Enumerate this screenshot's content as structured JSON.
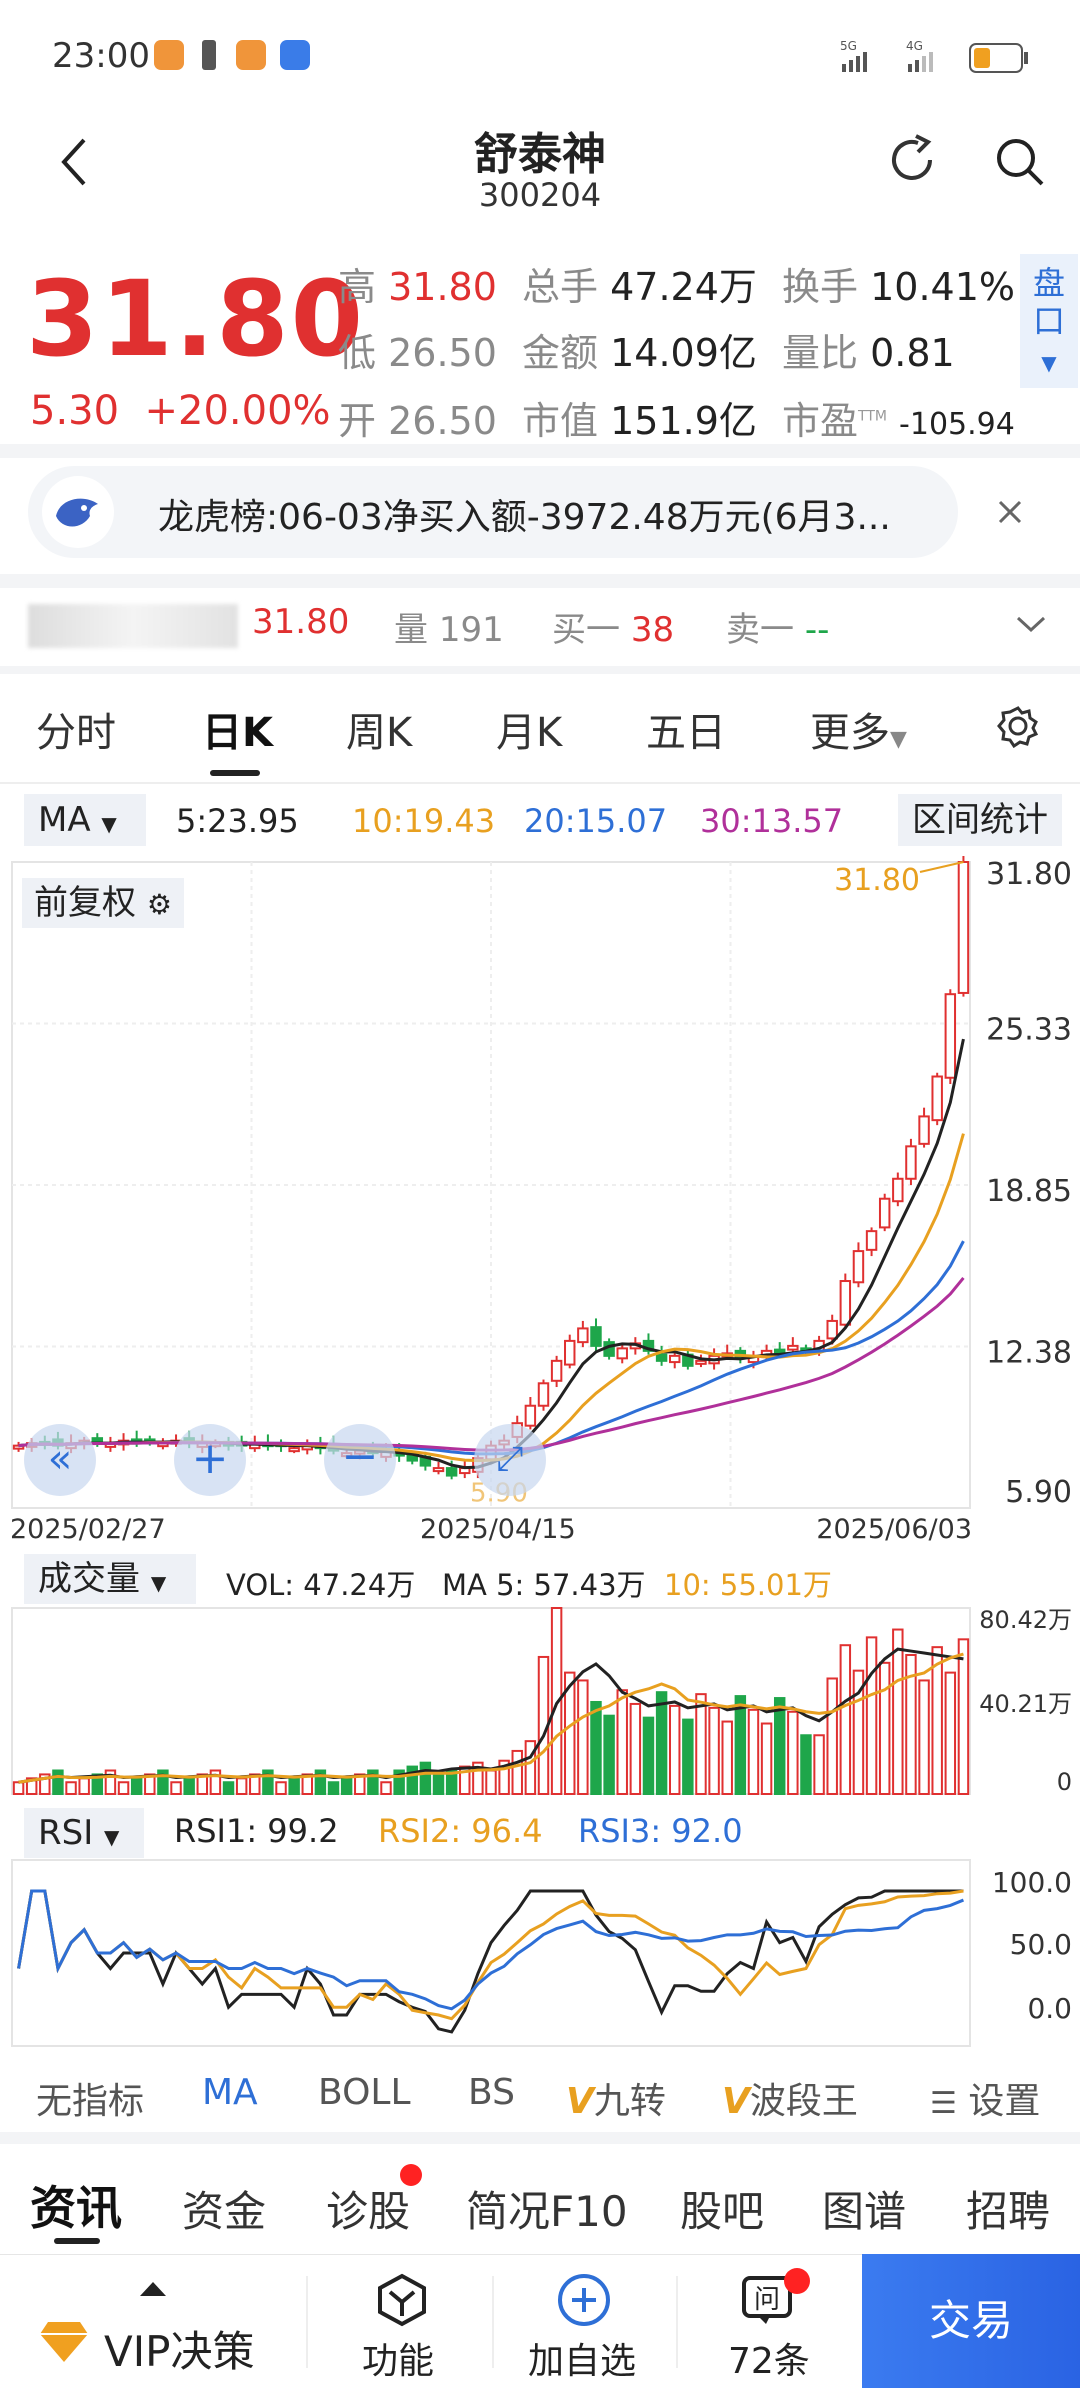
{
  "status": {
    "time": "23:00"
  },
  "header": {
    "title": "舒泰神",
    "code": "300204"
  },
  "quote": {
    "price": "31.80",
    "change": "5.30",
    "change_pct": "+20.00%",
    "high_label": "高",
    "high": "31.80",
    "low_label": "低",
    "low": "26.50",
    "open_label": "开",
    "open": "26.50",
    "vol_label": "总手",
    "vol": "47.24万",
    "amount_label": "金额",
    "amount": "14.09亿",
    "mcap_label": "市值",
    "mcap": "151.9亿",
    "turnover_label": "换手",
    "turnover": "10.41%",
    "ratio_label": "量比",
    "ratio": "0.81",
    "pe_label": "市盈",
    "pe_sup": "TTM",
    "pe": "-105.94",
    "pankou": "盘口"
  },
  "news": {
    "text": "龙虎榜:06-03净买入额-3972.48万元(6月3..."
  },
  "ticker": {
    "price": "31.80",
    "vol_label": "量",
    "vol": "191",
    "buy_label": "买一",
    "buy": "38",
    "sell_label": "卖一",
    "sell": "--"
  },
  "ktabs": [
    "分时",
    "日K",
    "周K",
    "月K",
    "五日",
    "更多"
  ],
  "ma": {
    "selector": "MA",
    "ma5": "5:23.95",
    "ma10": "10:19.43",
    "ma20": "20:15.07",
    "ma30": "30:13.57",
    "range_stats": "区间统计"
  },
  "colors": {
    "up": "#e03030",
    "down": "#1ea64a",
    "ma5": "#222222",
    "ma10": "#e8a020",
    "ma20": "#2e6fd6",
    "ma30": "#b0309a"
  },
  "adjust_label": "前复权",
  "kline": {
    "y_ticks": [
      "31.80",
      "25.33",
      "18.85",
      "12.38",
      "5.90"
    ],
    "dates": [
      "2025/02/27",
      "2025/04/15",
      "2025/06/03"
    ],
    "max_label": "31.80",
    "min_label": "5.90"
  },
  "volume": {
    "selector": "成交量",
    "vol": "VOL: 47.24万",
    "ma5": "MA 5: 57.43万",
    "ma10": "10: 55.01万",
    "ticks": [
      "80.42万",
      "40.21万",
      "0"
    ]
  },
  "rsi": {
    "selector": "RSI",
    "rsi1": "RSI1: 99.2",
    "rsi2": "RSI2: 96.4",
    "rsi3": "RSI3: 92.0",
    "ticks": [
      "100.0",
      "50.0",
      "0.0"
    ]
  },
  "indicators": [
    "无指标",
    "MA",
    "BOLL",
    "BS",
    "九转",
    "波段王",
    "设置"
  ],
  "bottom_tabs": [
    "资讯",
    "资金",
    "诊股",
    "简况F10",
    "股吧",
    "图谱",
    "招聘"
  ],
  "bottom_nav": {
    "vip": "VIP决策",
    "func": "功能",
    "add": "加自选",
    "ask": "72条",
    "trade": "交易"
  },
  "chart_data": {
    "type": "candlestick",
    "x_start": "2025/02/27",
    "x_mid": "2025/04/15",
    "x_end": "2025/06/03",
    "ylim": [
      5.9,
      31.8
    ],
    "closes": [
      8.4,
      8.5,
      8.5,
      8.4,
      8.5,
      8.6,
      8.5,
      8.5,
      8.6,
      8.5,
      8.6,
      8.5,
      8.6,
      8.5,
      8.5,
      8.5,
      8.4,
      8.4,
      8.5,
      8.4,
      8.4,
      8.3,
      8.4,
      8.3,
      8.2,
      8.1,
      8.2,
      8.1,
      8.2,
      8.0,
      7.8,
      7.6,
      7.5,
      7.2,
      7.5,
      7.9,
      8.4,
      8.6,
      9.3,
      10.0,
      10.9,
      11.8,
      12.6,
      13.1,
      12.4,
      12.0,
      12.3,
      12.5,
      12.2,
      11.8,
      12.0,
      11.6,
      11.8,
      12.0,
      12.1,
      11.9,
      12.0,
      12.2,
      12.1,
      12.4,
      12.2,
      12.6,
      13.4,
      15.0,
      16.2,
      17.0,
      18.3,
      19.1,
      20.4,
      21.6,
      23.2,
      26.5,
      31.8
    ],
    "volume_ticks_max": 80.42,
    "rsi": {
      "rsi1": 99.2,
      "rsi2": 96.4,
      "rsi3": 92.0
    }
  }
}
